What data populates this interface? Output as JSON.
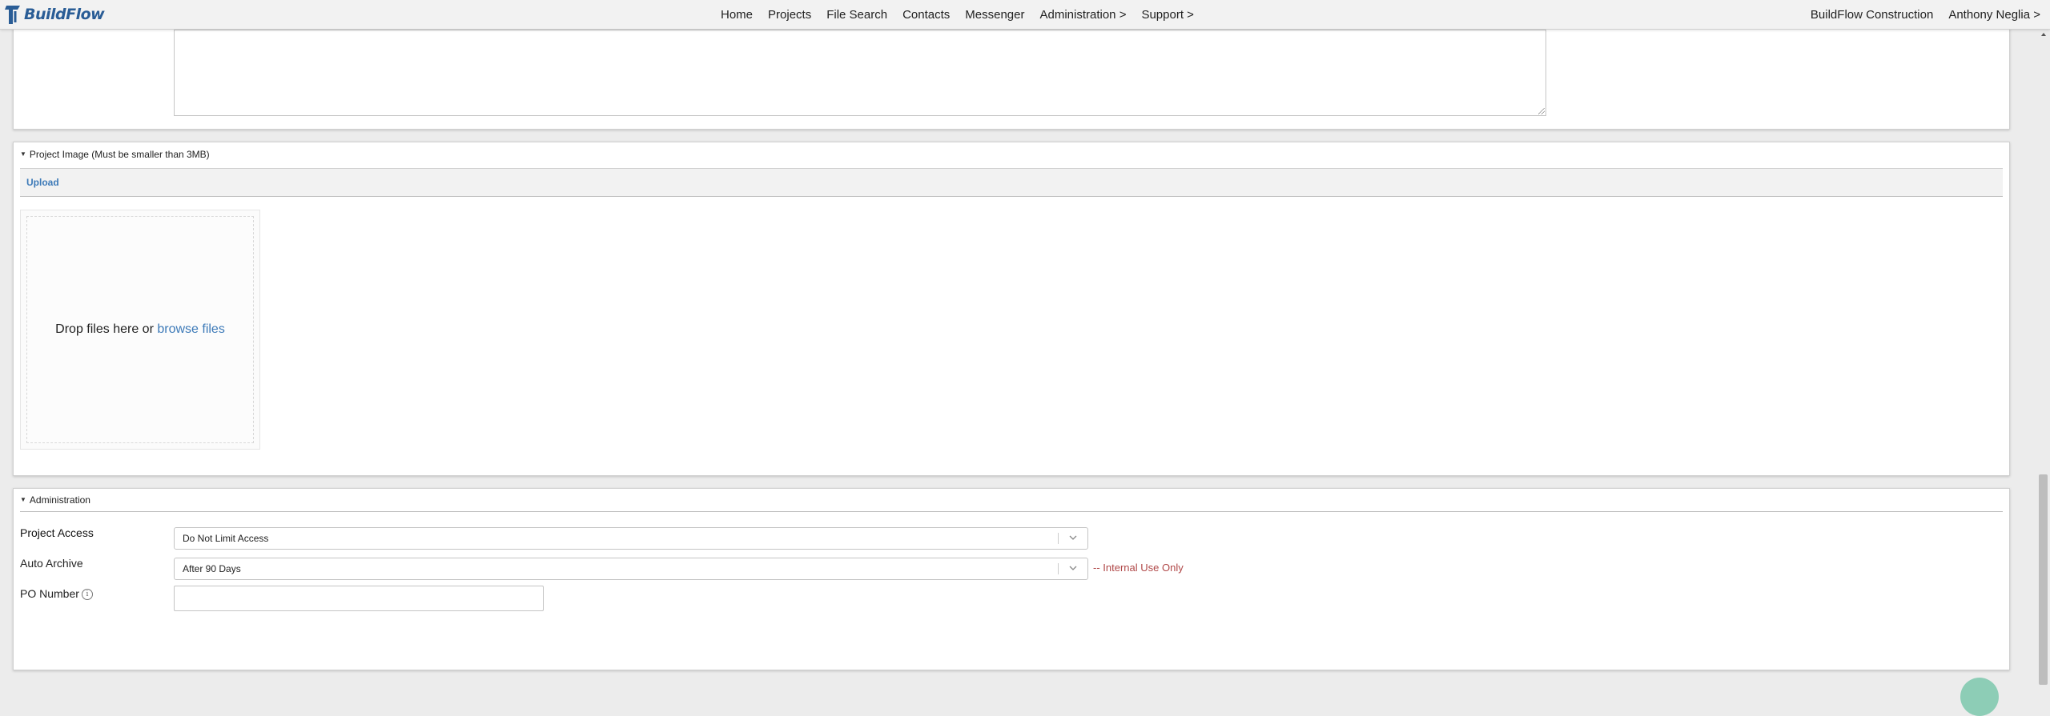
{
  "brand": {
    "name": "BuildFlow",
    "color": "#2a5d96"
  },
  "nav": [
    {
      "label": "Home"
    },
    {
      "label": "Projects"
    },
    {
      "label": "File Search"
    },
    {
      "label": "Contacts"
    },
    {
      "label": "Messenger"
    },
    {
      "label": "Administration >"
    },
    {
      "label": "Support >"
    }
  ],
  "top_right": {
    "company": "BuildFlow Construction",
    "user": "Anthony Neglia >"
  },
  "project_image": {
    "title": "Project Image (Must be smaller than 3MB)",
    "upload_label": "Upload",
    "drop_text": "Drop files here or",
    "browse_label": "browse files"
  },
  "administration": {
    "title": "Administration",
    "project_access": {
      "label": "Project Access",
      "value": "Do Not Limit Access"
    },
    "auto_archive": {
      "label": "Auto Archive",
      "value": "After 90 Days",
      "note": "-- Internal Use Only"
    },
    "po_number": {
      "label": "PO Number",
      "value": "",
      "info_icon": "info-icon"
    }
  },
  "colors": {
    "link": "#3d7ab8",
    "note": "#b04848",
    "fab": "#3fb58a"
  }
}
